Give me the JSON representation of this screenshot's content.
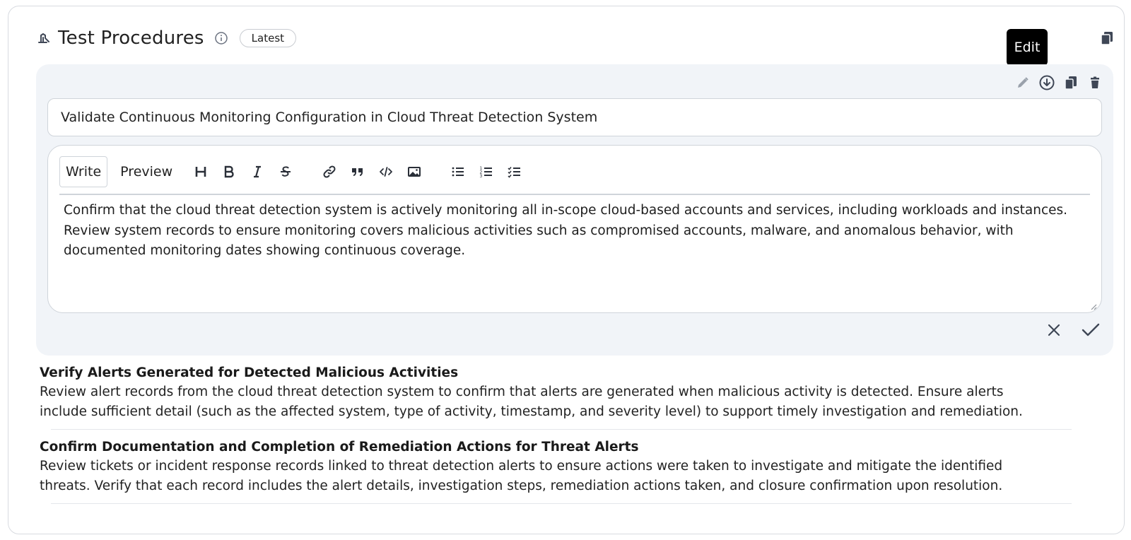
{
  "header": {
    "title": "Test Procedures",
    "badge": "Latest",
    "title_icon": "procedure-icon",
    "info_icon": "info-icon"
  },
  "tooltip": {
    "text": "Edit"
  },
  "panel": {
    "title_value": "Validate Continuous Monitoring Configuration in Cloud Threat Detection System",
    "tabs": {
      "write": "Write",
      "preview": "Preview"
    },
    "toolbar_icons": [
      "heading-icon",
      "bold-icon",
      "italic-icon",
      "strikethrough-icon",
      "link-icon",
      "quote-icon",
      "code-icon",
      "image-icon",
      "bulleted-list-icon",
      "numbered-list-icon",
      "task-list-icon"
    ],
    "body_text": "Confirm that the cloud threat detection system is actively monitoring all in-scope cloud-based accounts and services, including workloads and instances. Review system records to ensure monitoring covers malicious activities such as compromised accounts, malware, and anomalous behavior, with documented monitoring dates showing continuous coverage."
  },
  "items": [
    {
      "title": "Verify Alerts Generated for Detected Malicious Activities",
      "description": "Review alert records from the cloud threat detection system to confirm that alerts are generated when malicious activity is detected. Ensure alerts include sufficient detail (such as the affected system, type of activity, timestamp, and severity level) to support timely investigation and remediation."
    },
    {
      "title": "Confirm Documentation and Completion of Remediation Actions for Threat Alerts",
      "description": "Review tickets or incident response records linked to threat detection alerts to ensure actions were taken to investigate and mitigate the identified threats. Verify that each record includes the alert details, investigation steps, remediation actions taken, and closure confirmation upon resolution."
    }
  ],
  "colors": {
    "panel_bg": "#f1f4f8",
    "border": "#cfd4da",
    "icon": "#3f4756",
    "tooltip_bg": "#000000"
  }
}
